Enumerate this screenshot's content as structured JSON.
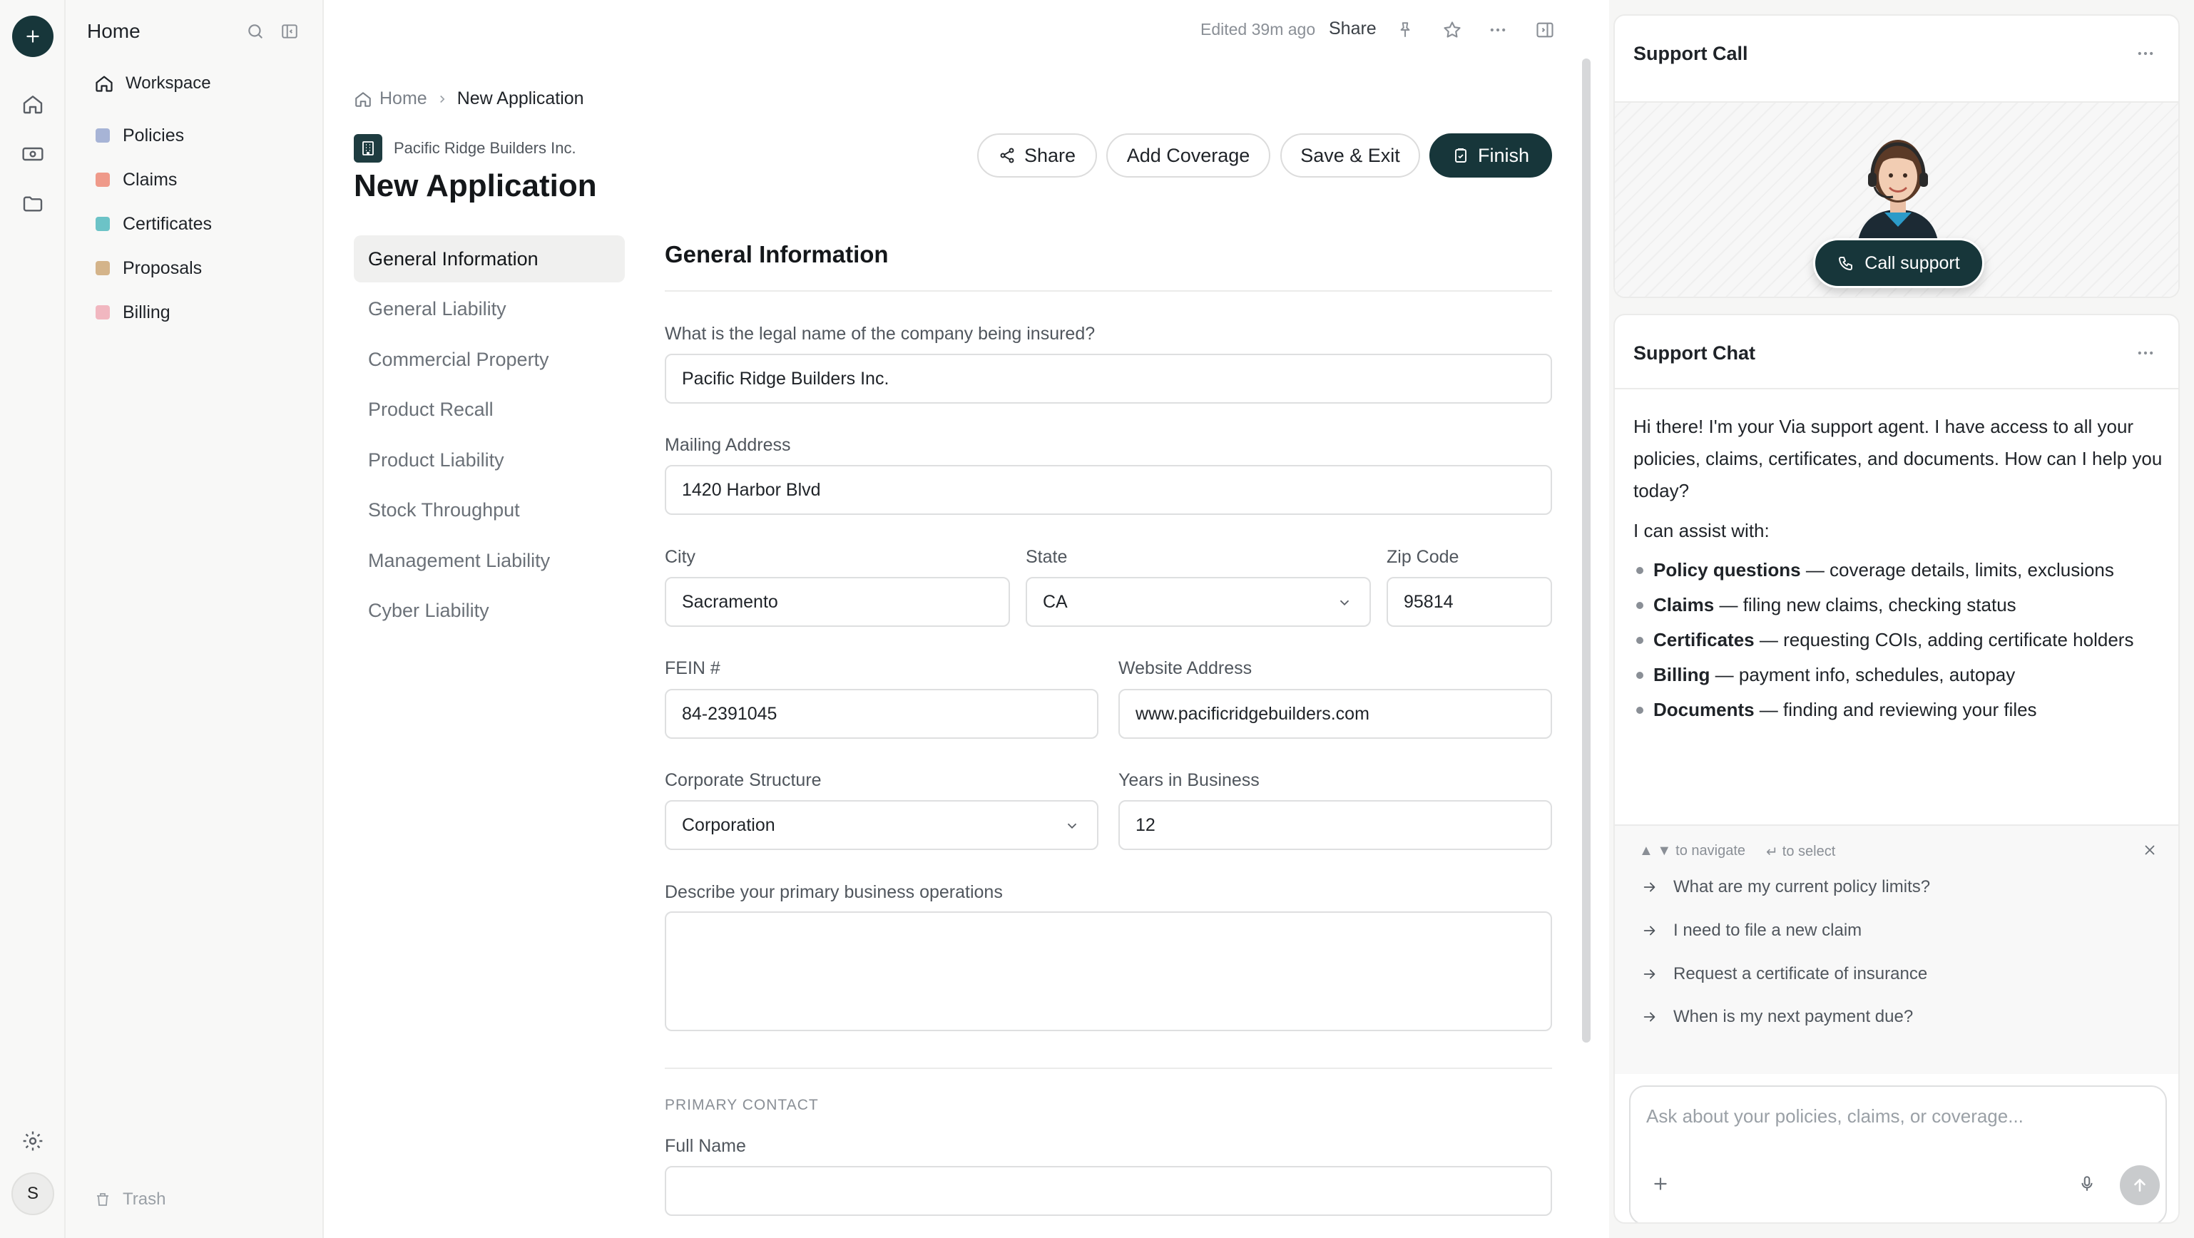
{
  "rail": {
    "avatar_initial": "S"
  },
  "sidebar": {
    "title": "Home",
    "workspace_label": "Workspace",
    "items": [
      {
        "label": "Policies",
        "color": "#a7b4d6"
      },
      {
        "label": "Claims",
        "color": "#ef9a8a"
      },
      {
        "label": "Certificates",
        "color": "#6cc3c7"
      },
      {
        "label": "Proposals",
        "color": "#d4b48a"
      },
      {
        "label": "Billing",
        "color": "#f1b7c0"
      }
    ],
    "trash_label": "Trash"
  },
  "topbar": {
    "edited": "Edited 39m ago",
    "share": "Share"
  },
  "breadcrumb": {
    "home": "Home",
    "current": "New Application"
  },
  "header": {
    "company": "Pacific Ridge Builders Inc.",
    "title": "New Application",
    "buttons": {
      "share": "Share",
      "add_coverage": "Add Coverage",
      "save_exit": "Save & Exit",
      "finish": "Finish"
    }
  },
  "nav": {
    "items": [
      "General Information",
      "General Liability",
      "Commercial Property",
      "Product Recall",
      "Product Liability",
      "Stock Throughput",
      "Management Liability",
      "Cyber Liability"
    ],
    "active_index": 0
  },
  "form": {
    "section_title": "General Information",
    "legal_name": {
      "label": "What is the legal name of the company being insured?",
      "value": "Pacific Ridge Builders Inc."
    },
    "mailing_address": {
      "label": "Mailing Address",
      "value": "1420 Harbor Blvd"
    },
    "city": {
      "label": "City",
      "value": "Sacramento"
    },
    "state": {
      "label": "State",
      "value": "CA"
    },
    "zip": {
      "label": "Zip Code",
      "value": "95814"
    },
    "fein": {
      "label": "FEIN #",
      "value": "84-2391045"
    },
    "website": {
      "label": "Website Address",
      "value": "www.pacificridgebuilders.com"
    },
    "corporate_structure": {
      "label": "Corporate Structure",
      "value": "Corporation"
    },
    "years_in_business": {
      "label": "Years in Business",
      "value": "12"
    },
    "operations": {
      "label": "Describe your primary business operations",
      "value": ""
    },
    "primary_contact_heading": "PRIMARY CONTACT",
    "full_name": {
      "label": "Full Name",
      "value": ""
    }
  },
  "support_call": {
    "title": "Support Call",
    "button": "Call support"
  },
  "support_chat": {
    "title": "Support Chat",
    "message": "Hi there! I'm your Via support agent. I have access to all your policies, claims, certificates, and documents. How can I help you today?",
    "assist_intro": "I can assist with:",
    "assist_items": [
      {
        "bold": "Policy questions",
        "rest": " — coverage details, limits, exclusions"
      },
      {
        "bold": "Claims",
        "rest": " — filing new claims, checking status"
      },
      {
        "bold": "Certificates",
        "rest": " — requesting COIs, adding certificate holders"
      },
      {
        "bold": "Billing",
        "rest": " — payment info, schedules, autopay"
      },
      {
        "bold": "Documents",
        "rest": " — finding and reviewing your files"
      }
    ],
    "hint_navigate": "to navigate",
    "hint_select": "to select",
    "suggestions": [
      "What are my current policy limits?",
      "I need to file a new claim",
      "Request a certificate of insurance",
      "When is my next payment due?"
    ],
    "input_placeholder": "Ask about your policies, claims, or coverage..."
  }
}
